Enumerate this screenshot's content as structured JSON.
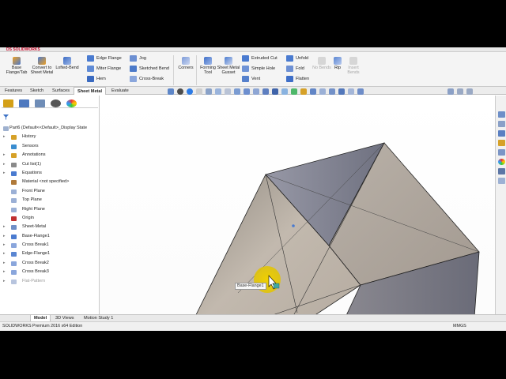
{
  "app": {
    "logo": "DS SOLIDWORKS"
  },
  "ribbon": {
    "big_buttons": [
      {
        "label": "Base Flange/Tab",
        "icon": "base-flange-icon"
      },
      {
        "label": "Convert to Sheet Metal",
        "icon": "convert-icon"
      },
      {
        "label": "Lofted-Bend",
        "icon": "lofted-bend-icon"
      },
      {
        "label": "Corners",
        "icon": "corners-icon"
      },
      {
        "label": "Forming Tool",
        "icon": "forming-tool-icon"
      },
      {
        "label": "Sheet Metal Gusset",
        "icon": "gusset-icon"
      },
      {
        "label": "No Bends",
        "icon": "no-bends-icon",
        "disabled": true
      },
      {
        "label": "Rip",
        "icon": "rip-icon"
      },
      {
        "label": "Insert Bends",
        "icon": "insert-bends-icon",
        "disabled": true
      }
    ],
    "small_buttons": {
      "edge_flange": "Edge Flange",
      "miter_flange": "Miter Flange",
      "hem": "Hem",
      "jog": "Jog",
      "sketched_bend": "Sketched Bend",
      "cross_break": "Cross-Break",
      "extruded_cut": "Extruded Cut",
      "simple_hole": "Simple Hole",
      "vent": "Vent",
      "unfold": "Unfold",
      "fold": "Fold",
      "flatten": "Flatten"
    }
  },
  "command_tabs": [
    "Features",
    "Sketch",
    "Surfaces",
    "Sheet Metal",
    "Evaluate"
  ],
  "active_command_tab": "Sheet Metal",
  "tree": {
    "root": "Part6  (Default<<Default>_Display State",
    "items": [
      {
        "label": "History",
        "icon": "history-icon",
        "expandable": true
      },
      {
        "label": "Sensors",
        "icon": "sensors-icon",
        "expandable": false
      },
      {
        "label": "Annotations",
        "icon": "annotations-icon",
        "expandable": true
      },
      {
        "label": "Cut list(1)",
        "icon": "cut-list-icon",
        "expandable": true
      },
      {
        "label": "Equations",
        "icon": "equations-icon",
        "expandable": true
      },
      {
        "label": "Material <not specified>",
        "icon": "material-icon",
        "expandable": false
      },
      {
        "label": "Front Plane",
        "icon": "plane-icon",
        "expandable": false
      },
      {
        "label": "Top Plane",
        "icon": "plane-icon",
        "expandable": false
      },
      {
        "label": "Right Plane",
        "icon": "plane-icon",
        "expandable": false
      },
      {
        "label": "Origin",
        "icon": "origin-icon",
        "expandable": false
      },
      {
        "label": "Sheet-Metal",
        "icon": "sheet-metal-icon",
        "expandable": true
      },
      {
        "label": "Base-Flange1",
        "icon": "base-flange-icon",
        "expandable": true
      },
      {
        "label": "Cross Break1",
        "icon": "cross-break-icon",
        "expandable": true
      },
      {
        "label": "Edge-Flange1",
        "icon": "edge-flange-icon",
        "expandable": true
      },
      {
        "label": "Cross Break2",
        "icon": "cross-break-icon",
        "expandable": true
      },
      {
        "label": "Cross Break3",
        "icon": "cross-break-icon",
        "expandable": true
      },
      {
        "label": "Flat-Pattern",
        "icon": "flat-pattern-icon",
        "expandable": true,
        "suppressed": true
      }
    ]
  },
  "viewport": {
    "tooltip": "Base-Flange1"
  },
  "bottom_tabs": [
    "Model",
    "3D Views",
    "Motion Study 1"
  ],
  "active_bottom_tab": "Model",
  "status": {
    "text": "SOLIDWORKS Premium 2016 x64 Edition",
    "units": "MMGS"
  },
  "colors": {
    "highlight": "#e2c400",
    "part_light": "#b8aea4",
    "part_dark": "#7c7d8a",
    "accent": "#2a5db0"
  }
}
